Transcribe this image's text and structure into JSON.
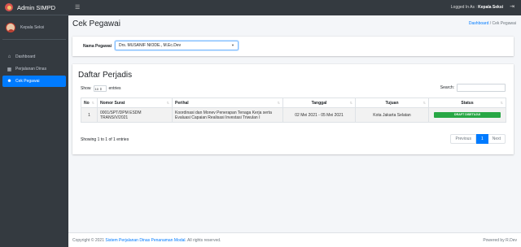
{
  "app": {
    "title": "Admin SIMPD"
  },
  "topbar": {
    "login_prefix": "Logged In As :",
    "login_user": "Kepala Seksi",
    "menu_icon": "hamburger-icon",
    "logout_icon": "logout-icon"
  },
  "sidebar": {
    "user_name": "Kepala Seksi",
    "items": [
      {
        "label": "Dashboard",
        "icon": "home-icon"
      },
      {
        "label": "Perjalanan Dinas",
        "icon": "map-icon"
      },
      {
        "label": "Cek Pegawai",
        "icon": "users-icon"
      }
    ]
  },
  "page": {
    "title": "Cek Pegawai"
  },
  "breadcrumb": {
    "home": "Dashboard",
    "separator": "/",
    "current": "Cek Pegawai"
  },
  "filter": {
    "label": "Nama Pegawai",
    "value": "Drs. MUSANIF NIODE., M.Ec.Dev"
  },
  "list": {
    "title": "Daftar Perjadis",
    "show_label": "Show",
    "length_value": "10",
    "entries_label": "entries",
    "search_label": "Search:",
    "columns": [
      "No",
      "Nomor Surat",
      "Perihal",
      "Tanggal",
      "Tujuan",
      "Status"
    ],
    "rows": [
      {
        "no": "1",
        "nomor_surat": "0001/SPT/DPM ESDM TRANS/V/2021",
        "perihal": "Koordinasi dan Monev Penerapan Tenaga Kerja serta Evaluasi Capaian Realisasi Investasi Triwulan I",
        "tanggal": "02 Mei 2021 - 05 Mei 2021",
        "tujuan": "Kota Jakarta Selatan",
        "status": "DRAFT DISETUJUI"
      }
    ],
    "info": "Showing 1 to 1 of 1 entries",
    "pagination": {
      "previous": "Previous",
      "current": "1",
      "next": "Next"
    }
  },
  "footer": {
    "copyright_prefix": "Copyright © 2021",
    "system_name": "Sistem Perjalanan Dinas Penanaman Modal",
    "rights": ". All rights reserved.",
    "powered": "Powered by R.Dev"
  },
  "colors": {
    "primary": "#007bff",
    "success": "#28a745",
    "sidebar": "#343a40"
  }
}
